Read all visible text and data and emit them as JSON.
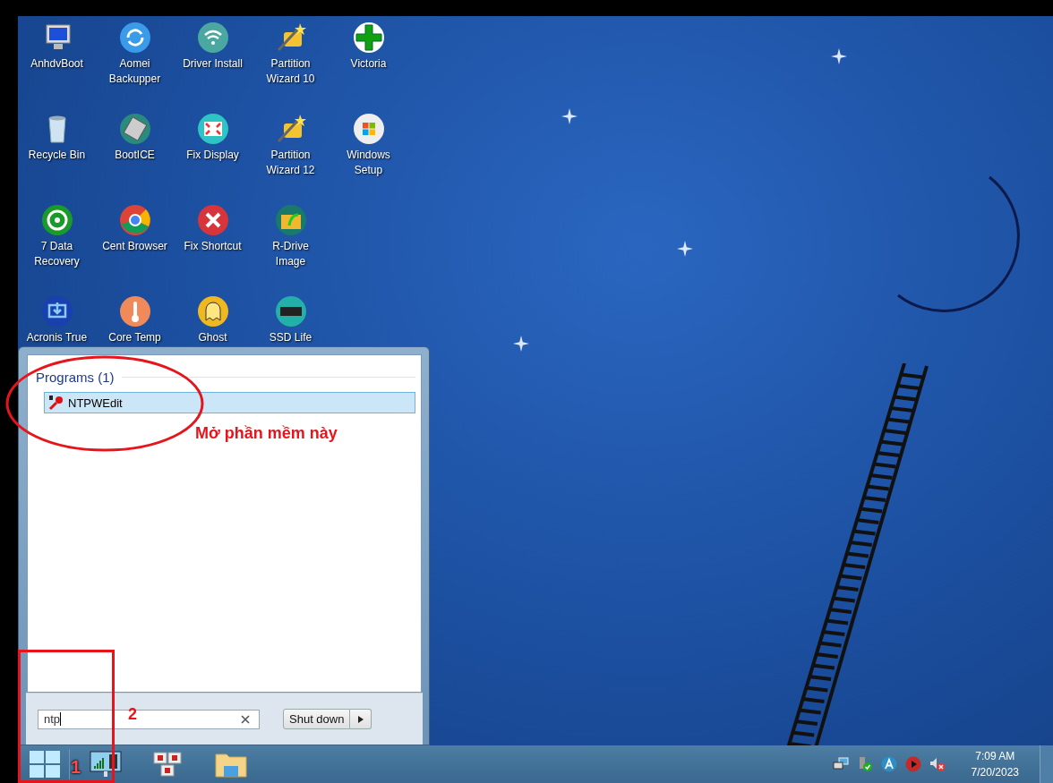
{
  "desktop_icons": [
    {
      "lines": [
        "AnhdvBoot"
      ]
    },
    {
      "lines": [
        "Aomei",
        "Backupper"
      ]
    },
    {
      "lines": [
        "Driver Install"
      ]
    },
    {
      "lines": [
        "Partition",
        "Wizard 10"
      ]
    },
    {
      "lines": [
        "Victoria"
      ]
    },
    {
      "lines": [
        "Recycle Bin"
      ]
    },
    {
      "lines": [
        "BootICE"
      ]
    },
    {
      "lines": [
        "Fix Display"
      ]
    },
    {
      "lines": [
        "Partition",
        "Wizard 12"
      ]
    },
    {
      "lines": [
        "Windows",
        "Setup"
      ]
    },
    {
      "lines": [
        "7 Data",
        "Recovery"
      ]
    },
    {
      "lines": [
        "Cent Browser"
      ]
    },
    {
      "lines": [
        "Fix Shortcut"
      ]
    },
    {
      "lines": [
        "R-Drive",
        "Image"
      ]
    },
    {
      "lines": [
        "Acronis True"
      ]
    },
    {
      "lines": [
        "Core Temp"
      ]
    },
    {
      "lines": [
        "Ghost"
      ]
    },
    {
      "lines": [
        "SSD Life"
      ]
    }
  ],
  "start_menu": {
    "section_title": "Programs (1)",
    "results": [
      {
        "label": "NTPWEdit",
        "selected": true
      }
    ],
    "search": {
      "value": "ntp"
    },
    "shutdown_button": "Shut down"
  },
  "taskbar": {
    "clock_time": "7:09 AM",
    "clock_date": "7/20/2023"
  },
  "annotations": {
    "note": "Mở phần mềm này",
    "step_1": "1",
    "step_2": "2"
  }
}
